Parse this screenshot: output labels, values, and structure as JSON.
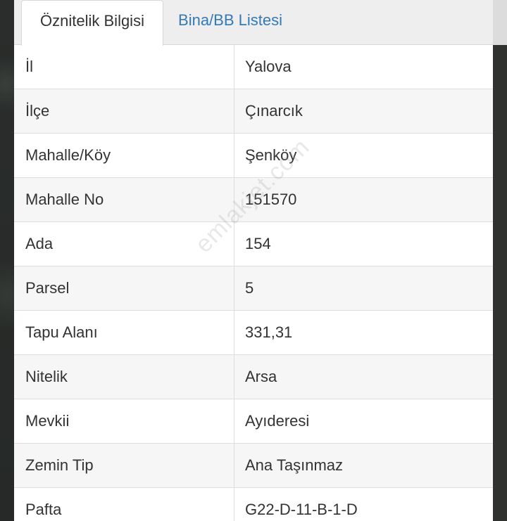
{
  "tabs": [
    {
      "label": "Öznitelik Bilgisi",
      "active": true
    },
    {
      "label": "Bina/BB Listesi",
      "active": false
    }
  ],
  "rows": [
    {
      "key": "İl",
      "value": "Yalova"
    },
    {
      "key": "İlçe",
      "value": "Çınarcık"
    },
    {
      "key": "Mahalle/Köy",
      "value": "Şenköy"
    },
    {
      "key": "Mahalle No",
      "value": "151570"
    },
    {
      "key": "Ada",
      "value": "154"
    },
    {
      "key": "Parsel",
      "value": "5"
    },
    {
      "key": "Tapu Alanı",
      "value": "331,31"
    },
    {
      "key": "Nitelik",
      "value": "Arsa"
    },
    {
      "key": "Mevkii",
      "value": "Ayıderesi"
    },
    {
      "key": "Zemin Tip",
      "value": "Ana Taşınmaz"
    },
    {
      "key": "Pafta",
      "value": "G22-D-11-B-1-D"
    }
  ],
  "watermark": "emlakjet.com",
  "colors": {
    "tab_link": "#337ab7",
    "text": "#333333",
    "row_alt": "#f6f6f6",
    "border": "#dedede"
  }
}
